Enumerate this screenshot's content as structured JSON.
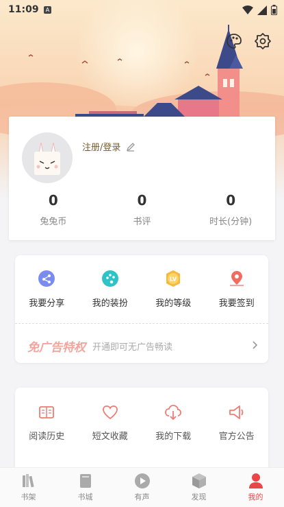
{
  "status_bar": {
    "time": "11:09",
    "notif_badge": "A"
  },
  "header": {
    "palette_icon": "palette-icon",
    "settings_icon": "gear-icon"
  },
  "profile": {
    "login_text": "注册/登录",
    "stats": [
      {
        "value": "0",
        "label": "兔兔币"
      },
      {
        "value": "0",
        "label": "书评"
      },
      {
        "value": "0",
        "label": "时长(分钟)"
      }
    ]
  },
  "features": {
    "items": [
      {
        "label": "我要分享",
        "icon": "share-icon"
      },
      {
        "label": "我的装扮",
        "icon": "palette-icon"
      },
      {
        "label": "我的等级",
        "icon": "level-badge-icon",
        "badge_text": "LV"
      },
      {
        "label": "我要签到",
        "icon": "map-pin-icon"
      }
    ],
    "ad_title": "免广告特权",
    "ad_subtitle": "开通即可无广告畅读"
  },
  "history": {
    "items": [
      {
        "label": "阅读历史",
        "icon": "book-open-icon"
      },
      {
        "label": "短文收藏",
        "icon": "heart-icon"
      },
      {
        "label": "我的下载",
        "icon": "cloud-download-icon"
      },
      {
        "label": "官方公告",
        "icon": "megaphone-icon"
      }
    ]
  },
  "tabs": [
    {
      "label": "书架",
      "icon": "bookshelf-icon",
      "active": false
    },
    {
      "label": "书城",
      "icon": "book-icon",
      "active": false
    },
    {
      "label": "有声",
      "icon": "play-icon",
      "active": false
    },
    {
      "label": "发现",
      "icon": "cube-icon",
      "active": false
    },
    {
      "label": "我的",
      "icon": "user-icon",
      "active": true
    }
  ],
  "colors": {
    "accent": "#e8474a",
    "sky_top": "#fbe6c8",
    "ad_title": "#f3a49d",
    "icon_pink": "#ef7b73"
  }
}
